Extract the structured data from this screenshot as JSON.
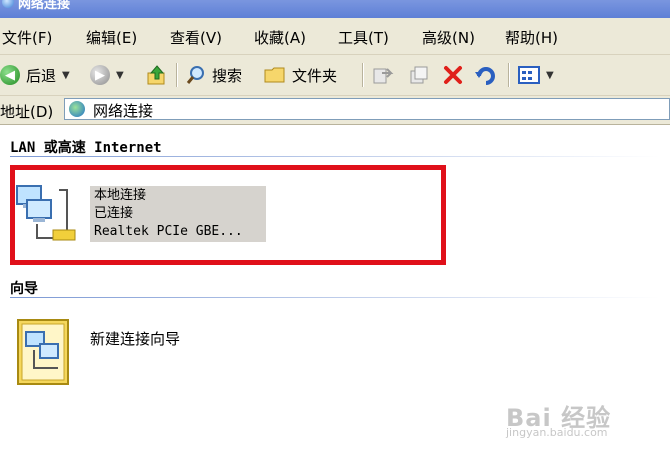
{
  "window": {
    "title": "网络连接"
  },
  "menu": {
    "items": [
      "文件(F)",
      "编辑(E)",
      "查看(V)",
      "收藏(A)",
      "工具(T)",
      "高级(N)",
      "帮助(H)"
    ]
  },
  "toolbar": {
    "back_label": "后退",
    "search_label": "搜索",
    "folders_label": "文件夹"
  },
  "address": {
    "label": "地址(D)",
    "value": "网络连接"
  },
  "groups": {
    "lan": {
      "header": "LAN 或高速 Internet",
      "item": {
        "name": "本地连接",
        "status": "已连接",
        "device": "Realtek PCIe GBE..."
      }
    },
    "wizard": {
      "header": "向导",
      "item": {
        "name": "新建连接向导"
      }
    }
  },
  "watermark": {
    "brand": "Bai 经验",
    "url": "jingyan.baidu.com"
  },
  "colors": {
    "highlight_border": "#e0101a",
    "chrome": "#ece9d8",
    "selection": "#d6d3ce"
  }
}
